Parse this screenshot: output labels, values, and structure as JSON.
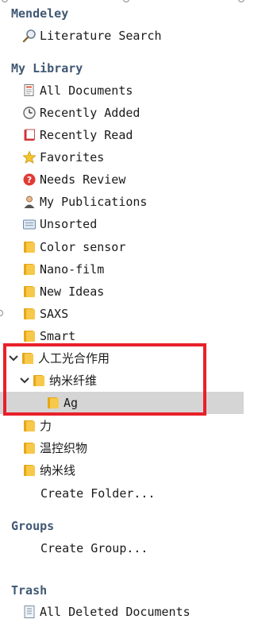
{
  "mendeley": {
    "title": "Mendeley",
    "literature_search": "Literature Search"
  },
  "library": {
    "title": "My Library",
    "items": [
      {
        "label": "All Documents",
        "icon": "documents-icon"
      },
      {
        "label": "Recently Added",
        "icon": "clock-icon"
      },
      {
        "label": "Recently Read",
        "icon": "book-icon"
      },
      {
        "label": "Favorites",
        "icon": "star-icon"
      },
      {
        "label": "Needs Review",
        "icon": "question-icon"
      },
      {
        "label": "My Publications",
        "icon": "person-icon"
      },
      {
        "label": "Unsorted",
        "icon": "tray-icon"
      }
    ],
    "folders": [
      "Color sensor",
      "Nano-film",
      "New Ideas",
      "SAXS",
      "Smart"
    ],
    "tree": {
      "root": "人工光合作用",
      "child": "纳米纤维",
      "grandchild": "Ag"
    },
    "folders_after": [
      "力",
      "温控织物",
      "纳米线"
    ],
    "create_folder": "Create Folder..."
  },
  "groups": {
    "title": "Groups",
    "create_group": "Create Group..."
  },
  "trash": {
    "title": "Trash",
    "all_deleted": "All Deleted Documents"
  },
  "colors": {
    "section_title": "#3f5873",
    "folder": "#f2b933",
    "highlight": "#e8202a",
    "selected_bg": "#d5d5d5"
  }
}
